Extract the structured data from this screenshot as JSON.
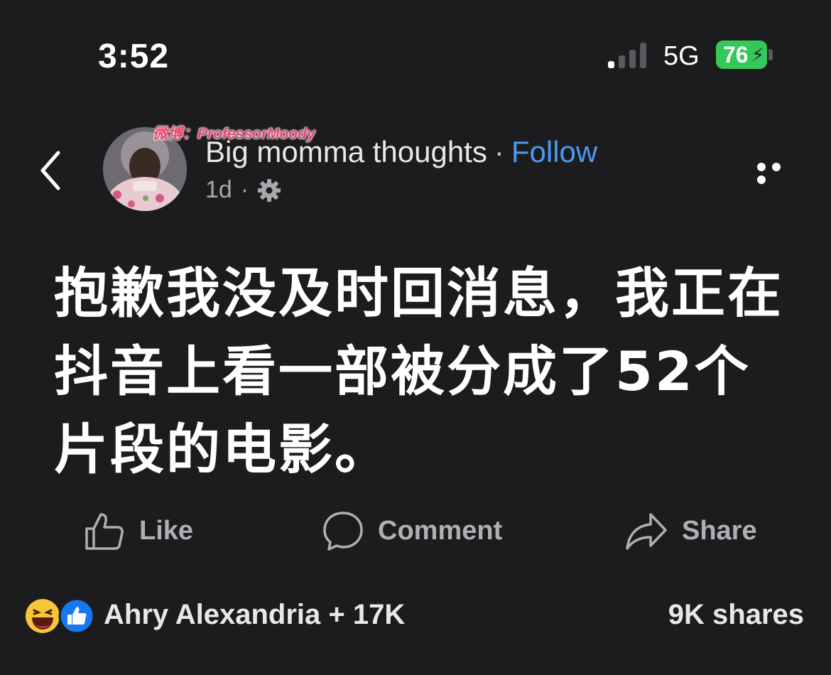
{
  "status_bar": {
    "time": "3:52",
    "network": "5G",
    "battery": "76"
  },
  "header": {
    "page_name": "Big momma thoughts",
    "separator": "·",
    "follow_label": "Follow",
    "timestamp": "1d",
    "meta_separator": "·",
    "watermark": "微博：ProfessorMoody"
  },
  "post": {
    "text": "抱歉我没及时回消息，我正在抖音上看一部被分成了52个片段的电影。"
  },
  "actions": {
    "like": "Like",
    "comment": "Comment",
    "share": "Share"
  },
  "footer": {
    "reactions_text": "Ahry Alexandria + 17K",
    "shares_text": "9K shares"
  },
  "colors": {
    "background": "#1c1c1e",
    "follow": "#4a9af2",
    "battery": "#34c759",
    "like_badge": "#1877f2"
  },
  "icons": [
    "back-chevron-icon",
    "gear-icon",
    "more-icon",
    "thumbs-up-icon",
    "comment-bubble-icon",
    "share-arrow-icon",
    "haha-reaction-icon",
    "like-reaction-icon"
  ]
}
